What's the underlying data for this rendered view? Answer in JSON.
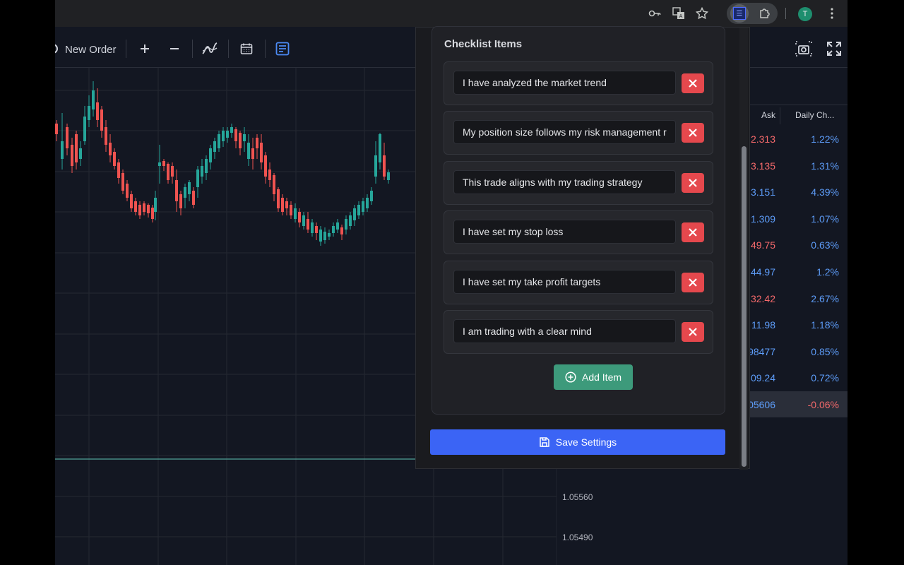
{
  "browser": {
    "icons": [
      "key-icon",
      "translate-icon",
      "star-icon",
      "checklist-extension-icon",
      "puzzle-icon",
      "more-icon"
    ],
    "avatar_initial": "T"
  },
  "toolbar": {
    "new_order_label": "New Order",
    "icons": [
      "plus-icon",
      "minus-icon",
      "indicators-icon",
      "calendar-icon",
      "notes-icon",
      "screenshot-icon",
      "fullscreen-icon"
    ]
  },
  "chart": {
    "price_labels": [
      "1.05560",
      "1.05490"
    ]
  },
  "watchlist": {
    "columns": [
      "Ask",
      "Daily Ch..."
    ],
    "rows": [
      {
        "ask": "2.313",
        "change": "1.22%",
        "ask_color": "red",
        "change_color": "blue"
      },
      {
        "ask": "3.135",
        "change": "1.31%",
        "ask_color": "red",
        "change_color": "blue"
      },
      {
        "ask": "3.151",
        "change": "4.39%",
        "ask_color": "blue",
        "change_color": "blue"
      },
      {
        "ask": "1.309",
        "change": "1.07%",
        "ask_color": "blue",
        "change_color": "blue"
      },
      {
        "ask": "49.75",
        "change": "0.63%",
        "ask_color": "red",
        "change_color": "blue"
      },
      {
        "ask": "44.97",
        "change": "1.2%",
        "ask_color": "blue",
        "change_color": "blue"
      },
      {
        "ask": "32.42",
        "change": "2.67%",
        "ask_color": "red",
        "change_color": "blue"
      },
      {
        "ask": "11.98",
        "change": "1.18%",
        "ask_color": "blue",
        "change_color": "blue"
      },
      {
        "ask": "98477",
        "change": "0.85%",
        "ask_color": "blue",
        "change_color": "blue"
      },
      {
        "ask": "09.24",
        "change": "0.72%",
        "ask_color": "blue",
        "change_color": "blue"
      },
      {
        "ask": "05606",
        "change": "-0.06%",
        "ask_color": "blue",
        "change_color": "red"
      }
    ]
  },
  "popup": {
    "section_title": "Checklist Items",
    "items": [
      "I have analyzed the market trend",
      "My position size follows my risk management rules",
      "This trade aligns with my trading strategy",
      "I have set my stop loss",
      "I have set my take profit targets",
      "I am trading with a clear mind"
    ],
    "add_label": "Add Item",
    "save_label": "Save Settings"
  },
  "colors": {
    "accent_blue": "#3b64f5",
    "add_green": "#3d9a7b",
    "delete_red": "#e5484d",
    "up_candle": "#26a69a",
    "down_candle": "#ef5350"
  }
}
